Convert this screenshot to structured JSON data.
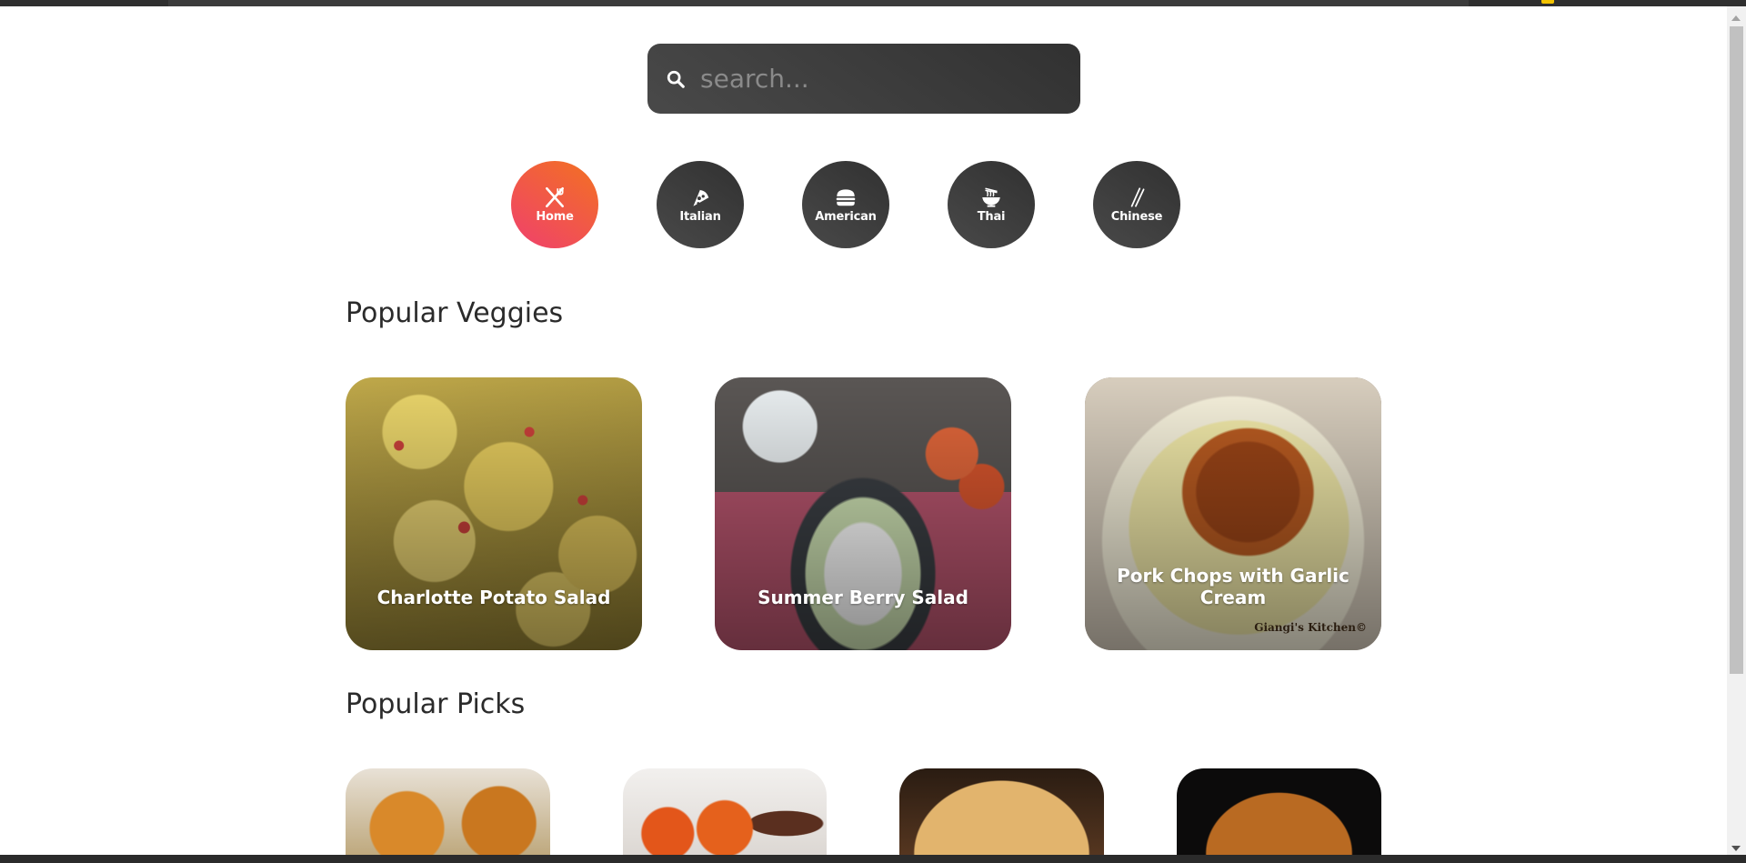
{
  "search": {
    "placeholder": "search..."
  },
  "categories": [
    {
      "label": "Home",
      "icon": "fork-knife-icon",
      "active": true
    },
    {
      "label": "Italian",
      "icon": "pizza-icon",
      "active": false
    },
    {
      "label": "American",
      "icon": "burger-icon",
      "active": false
    },
    {
      "label": "Thai",
      "icon": "noodle-bowl-icon",
      "active": false
    },
    {
      "label": "Chinese",
      "icon": "chopsticks-icon",
      "active": false
    }
  ],
  "veggies": {
    "title": "Popular Veggies",
    "cards": [
      {
        "title": "Charlotte Potato Salad"
      },
      {
        "title": "Summer Berry Salad"
      },
      {
        "title": "Pork Chops with Garlic Cream",
        "watermark": "Giangi's Kitchen©"
      }
    ]
  },
  "picks": {
    "title": "Popular Picks"
  },
  "colors": {
    "active_gradient_start": "#f0406d",
    "active_gradient_end": "#f27121",
    "dark_gradient_start": "#494949",
    "dark_gradient_end": "#313131"
  }
}
